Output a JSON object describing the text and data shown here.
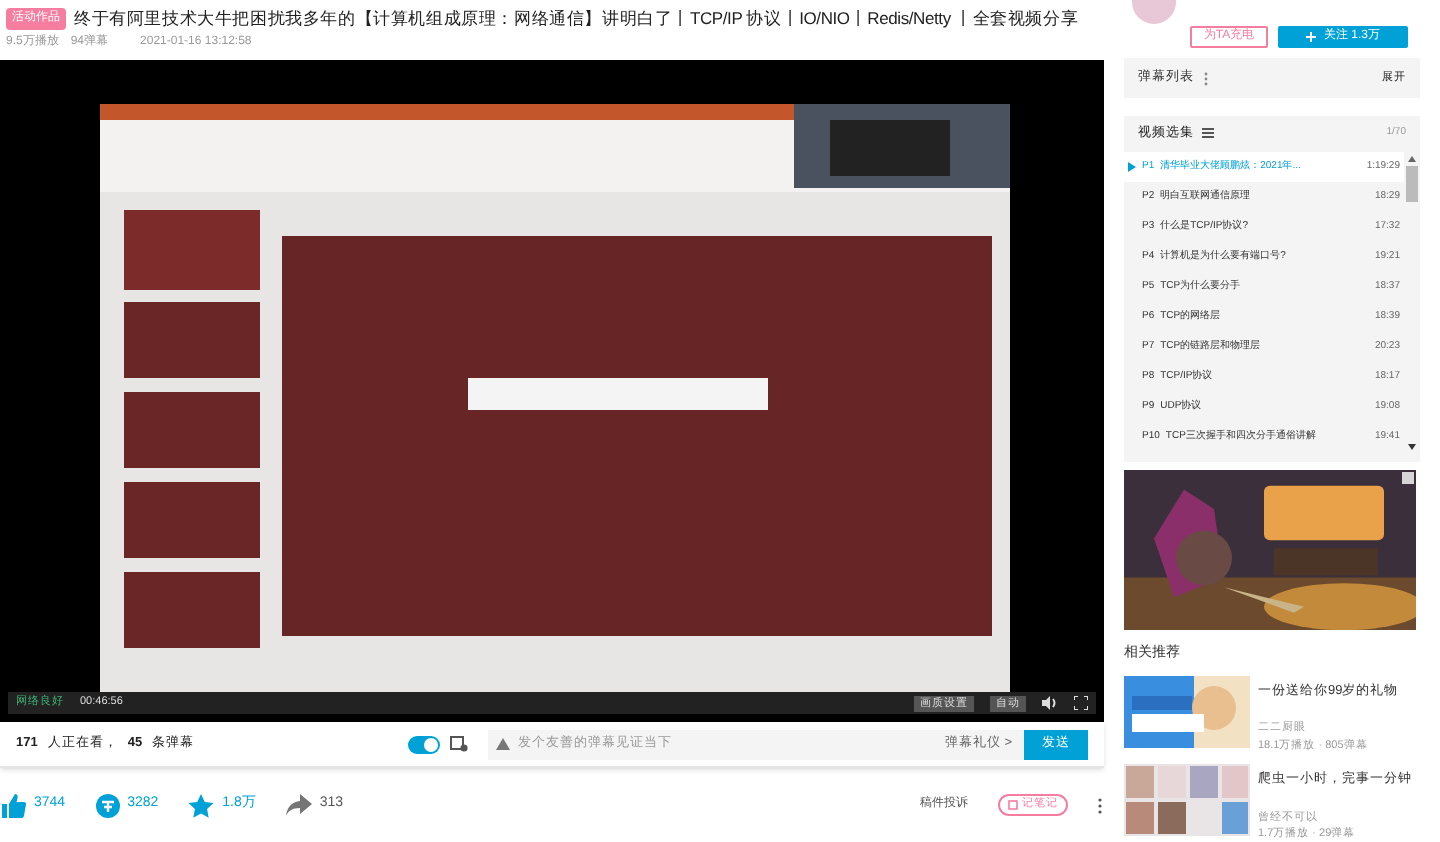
{
  "header": {
    "tag": "活动作品",
    "title": "终于有阿里技术大牛把困扰我多年的【计算机组成原理：网络通信】讲明白了丨TCP/IP 协议丨IO/NIO丨Redis/Netty 丨全套视频分享",
    "views": "9.5万播放",
    "danmaku": "94弹幕",
    "date": "2021-01-16 13:12:58"
  },
  "player": {
    "status": "网络良好",
    "time": "00:46:56",
    "buttons": [
      "画质设置",
      "自动"
    ]
  },
  "danmaku_bar": {
    "viewers": "171",
    "viewers_label": "人正在看，",
    "count": "45",
    "count_label": "条弹幕",
    "toggle_on": true,
    "placeholder": "发个友善的弹幕见证当下",
    "etiquette": "弹幕礼仪 >",
    "send": "发送"
  },
  "actions": [
    {
      "kind": "like",
      "count": "3744"
    },
    {
      "kind": "coin",
      "count": "3282"
    },
    {
      "kind": "star",
      "count": "1.8万"
    },
    {
      "kind": "share",
      "count": "313"
    }
  ],
  "report": "稿件投诉",
  "note": "记笔记",
  "uploader": {
    "charge": "为TA充电",
    "follow": "关注 1.3万"
  },
  "danmaku_list": {
    "title": "弹幕列表",
    "expand": "展开"
  },
  "playlist": {
    "title": "视频选集",
    "count": "1/70",
    "items": [
      {
        "index": "P1",
        "title": "清华毕业大佬顾鹏炫：2021年...",
        "duration": "1:19:29",
        "selected": true
      },
      {
        "index": "P2",
        "title": "明白互联网通信原理",
        "duration": "18:29",
        "selected": false
      },
      {
        "index": "P3",
        "title": "什么是TCP/IP协议?",
        "duration": "17:32",
        "selected": false
      },
      {
        "index": "P4",
        "title": "计算机是为什么要有端口号?",
        "duration": "19:21",
        "selected": false
      },
      {
        "index": "P5",
        "title": "TCP为什么要分手",
        "duration": "18:37",
        "selected": false
      },
      {
        "index": "P6",
        "title": "TCP的网络层",
        "duration": "18:39",
        "selected": false
      },
      {
        "index": "P7",
        "title": "TCP的链路层和物理层",
        "duration": "20:23",
        "selected": false
      },
      {
        "index": "P8",
        "title": "TCP/IP协议",
        "duration": "18:17",
        "selected": false
      },
      {
        "index": "P9",
        "title": "UDP协议",
        "duration": "19:08",
        "selected": false
      },
      {
        "index": "P10",
        "title": "TCP三次握手和四次分手通俗讲解",
        "duration": "19:41",
        "selected": false
      }
    ]
  },
  "related": {
    "title": "相关推荐",
    "items": [
      {
        "title": "一份送给你99岁的礼物",
        "author": "二二厨眼",
        "stats": "18.1万播放 · 805弹幕"
      },
      {
        "title": "爬虫一小时，完事一分钟",
        "author": "曾经不可以",
        "stats": "1.7万播放 · 29弹幕"
      }
    ]
  }
}
